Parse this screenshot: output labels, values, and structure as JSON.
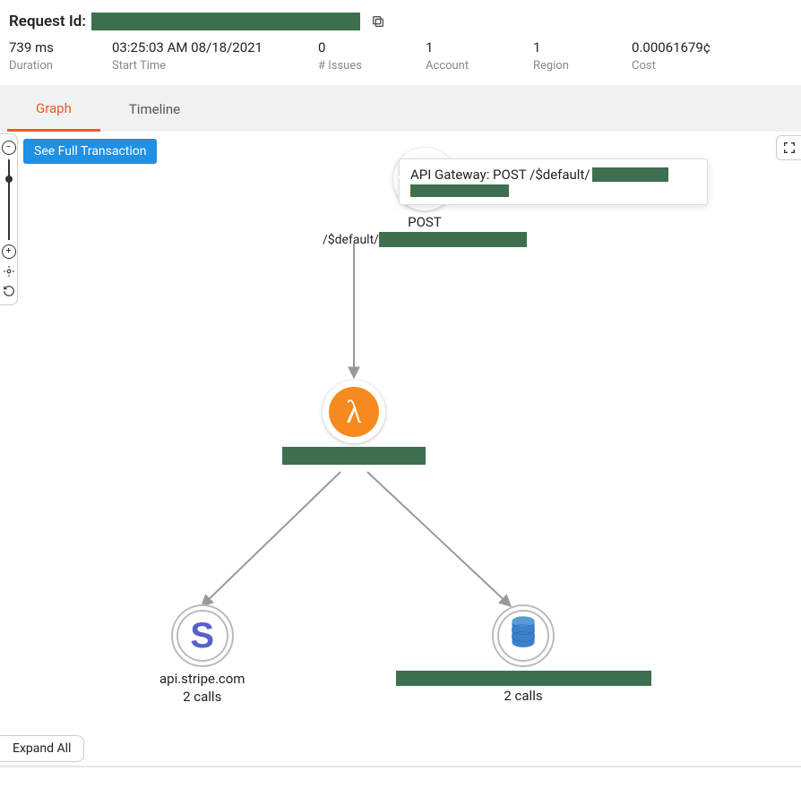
{
  "header": {
    "request_id_label": "Request Id:"
  },
  "stats": {
    "duration_value": "739 ms",
    "duration_label": "Duration",
    "start_time_value": "03:25:03 AM 08/18/2021",
    "start_time_label": "Start Time",
    "issues_value": "0",
    "issues_label": "# Issues",
    "account_value": "1",
    "account_label": "Account",
    "region_value": "1",
    "region_label": "Region",
    "cost_value": "0.00061679¢",
    "cost_label": "Cost"
  },
  "tabs": {
    "graph": "Graph",
    "timeline": "Timeline"
  },
  "buttons": {
    "see_full": "See Full Transaction",
    "expand_all": "Expand All"
  },
  "tooltip": {
    "prefix": "API Gateway: POST /$default/"
  },
  "nodes": {
    "apigw": {
      "method": "POST",
      "path_prefix": "/$default/"
    },
    "stripe": {
      "host": "api.stripe.com",
      "calls": "2 calls"
    },
    "ddb": {
      "calls": "2 calls"
    }
  },
  "icons": {
    "copy": "copy-icon",
    "zoom_out": "zoom-out-icon",
    "zoom_in": "zoom-in-icon",
    "locate": "locate-icon",
    "refresh": "refresh-icon",
    "fullscreen": "fullscreen-icon",
    "apigw": "api-gateway-icon",
    "lambda": "lambda-icon",
    "stripe": "stripe-icon",
    "dynamodb": "dynamodb-icon"
  }
}
